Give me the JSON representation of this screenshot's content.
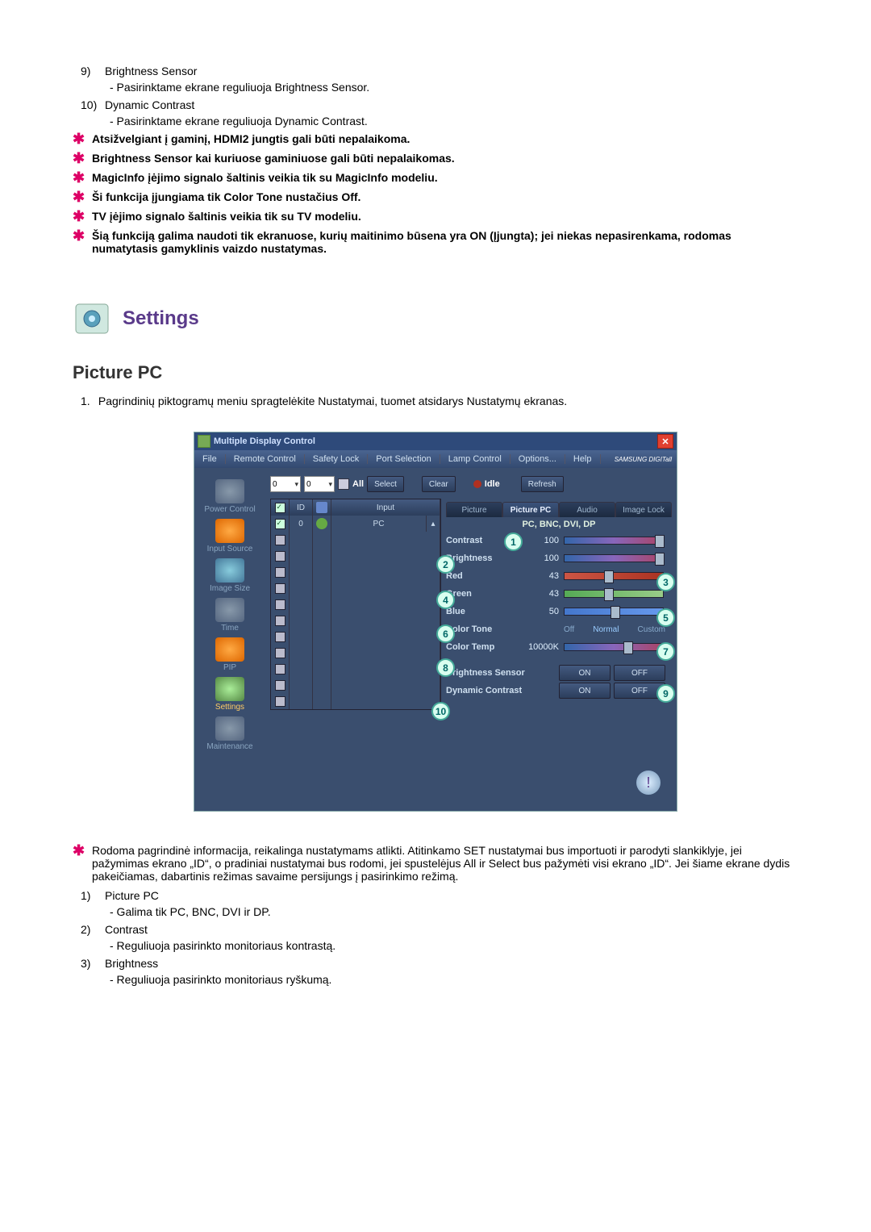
{
  "prelist": {
    "item9": {
      "num": "9)",
      "title": "Brightness Sensor",
      "sub": "- Pasirinktame ekrane reguliuoja Brightness Sensor."
    },
    "item10": {
      "num": "10)",
      "title": "Dynamic Contrast",
      "sub": "- Pasirinktame ekrane reguliuoja Dynamic Contrast."
    }
  },
  "notes": {
    "n1": "Atsižvelgiant į gaminį, HDMI2 jungtis gali būti nepalaikoma.",
    "n2": "Brightness Sensor kai kuriuose gaminiuose gali būti nepalaikomas.",
    "n3": "MagicInfo įėjimo signalo šaltinis veikia tik su MagicInfo modeliu.",
    "n4": "Ši funkcija įjungiama tik Color Tone nustačius Off.",
    "n5": "TV įėjimo signalo šaltinis veikia tik su TV modeliu.",
    "n6": "Šią funkciją galima naudoti tik ekranuose, kurių maitinimo būsena yra ON (Įjungta); jei niekas nepasirenkama, rodomas numatytasis gamyklinis vaizdo nustatymas."
  },
  "settings_title": "Settings",
  "section_heading": "Picture PC",
  "intro_num": "1.",
  "intro_text": "Pagrindinių piktogramų meniu spragtelėkite Nustatymai, tuomet atsidarys Nustatymų ekranas.",
  "app": {
    "title": "Multiple Display Control",
    "menu": {
      "file": "File",
      "remote": "Remote Control",
      "safety": "Safety Lock",
      "port": "Port Selection",
      "lamp": "Lamp Control",
      "options": "Options...",
      "help": "Help"
    },
    "brand": "SAMSUNG DIGITall",
    "sidebar": {
      "power": "Power Control",
      "input": "Input Source",
      "image": "Image Size",
      "time": "Time",
      "pip": "PIP",
      "settings": "Settings",
      "maint": "Maintenance"
    },
    "top": {
      "val0a": "0",
      "val0b": "0",
      "all": "All",
      "select": "Select",
      "clear": "Clear",
      "idle": "Idle",
      "refresh": "Refresh"
    },
    "table": {
      "hdr_id": "ID",
      "hdr_input": "Input",
      "row_id": "0",
      "row_input": "PC"
    },
    "tabs": {
      "picture": "Picture",
      "picturepc": "Picture PC",
      "audio": "Audio",
      "imagelock": "Image Lock"
    },
    "subheader": "PC, BNC, DVI, DP",
    "params": {
      "contrast": "Contrast",
      "contrast_v": "100",
      "brightness": "Brightness",
      "brightness_v": "100",
      "red": "Red",
      "red_v": "43",
      "green": "Green",
      "green_v": "43",
      "blue": "Blue",
      "blue_v": "50",
      "colortone": "Color Tone",
      "ct_off": "Off",
      "ct_normal": "Normal",
      "ct_custom": "Custom",
      "colortemp": "Color Temp",
      "colortemp_v": "10000K",
      "bsensor": "Brightness Sensor",
      "dcontrast": "Dynamic Contrast",
      "on": "ON",
      "off": "OFF"
    }
  },
  "callouts": {
    "c1": "1",
    "c2": "2",
    "c3": "3",
    "c4": "4",
    "c5": "5",
    "c6": "6",
    "c7": "7",
    "c8": "8",
    "c9": "9",
    "c10": "10"
  },
  "lower_note": "Rodoma pagrindinė informacija, reikalinga nustatymams atlikti. Atitinkamo SET nustatymai bus importuoti ir parodyti slankiklyje, jei pažymimas ekrano „ID“, o pradiniai nustatymai bus rodomi, jei spustelėjus All ir Select bus pažymėti visi ekrano „ID“. Jei šiame ekrane dydis pakeičiamas, dabartinis režimas savaime persijungs į pasirinkimo režimą.",
  "lower": {
    "i1": {
      "num": "1)",
      "title": "Picture PC",
      "sub": "- Galima tik PC, BNC, DVI ir DP."
    },
    "i2": {
      "num": "2)",
      "title": "Contrast",
      "sub": "- Reguliuoja pasirinkto monitoriaus kontrastą."
    },
    "i3": {
      "num": "3)",
      "title": "Brightness",
      "sub": "- Reguliuoja pasirinkto monitoriaus ryškumą."
    }
  }
}
